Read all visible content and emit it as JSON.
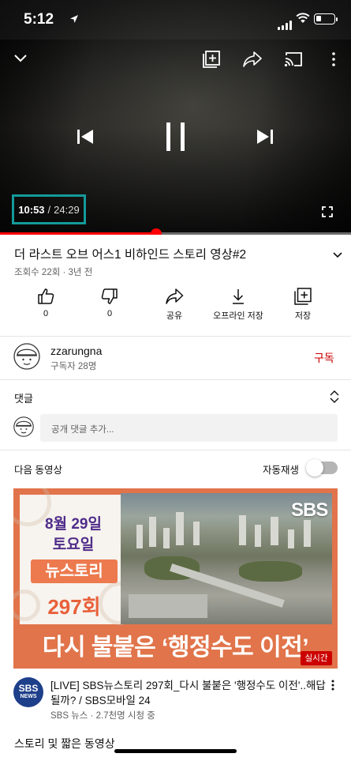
{
  "status_bar": {
    "time": "5:12",
    "battery_level": 0.3
  },
  "player": {
    "current_time": "10:53",
    "separator": "/",
    "duration": "24:29",
    "progress_fraction": 0.444
  },
  "video": {
    "title": "더 라스트 오브 어스1 비하인드 스토리 영상#2",
    "meta": "조회수 22회 · 3년 전"
  },
  "actions": [
    {
      "label": "0",
      "icon": "thumbs-up-icon"
    },
    {
      "label": "0",
      "icon": "thumbs-down-icon"
    },
    {
      "label": "공유",
      "icon": "share-icon"
    },
    {
      "label": "오프라인 저장",
      "icon": "download-icon"
    },
    {
      "label": "저장",
      "icon": "save-to-playlist-icon"
    }
  ],
  "channel": {
    "name": "zzarungna",
    "subscribers": "구독자 28명",
    "subscribe_label": "구독"
  },
  "comments": {
    "heading": "댓글",
    "placeholder": "공개 댓글 추가..."
  },
  "up_next": {
    "heading": "다음 동영상",
    "autoplay_label": "자동재생",
    "autoplay_on": false
  },
  "next_video": {
    "thumb_date": "8월 29일",
    "thumb_day": "토요일",
    "thumb_series": "뉴스토리",
    "thumb_episode": "297회",
    "thumb_logo": "SBS",
    "thumb_headline": "다시 불붙은 ‘행정수도 이전’",
    "live_badge": "실시간",
    "title": "[LIVE] SBS뉴스토리 297회_다시 불붙은 '행정수도 이전'..해답될까? / SBS모바일 24",
    "meta": "SBS 뉴스 · 2.7천명 시청 중",
    "channel_avatar_line1": "SBS",
    "channel_avatar_line2": "NEWS"
  },
  "section": {
    "heading": "스토리 및 짧은 동영상"
  },
  "colors": {
    "accent_red": "#ff0000",
    "subscribe_red": "#cc0000",
    "timebox_border": "#149a9a",
    "thumb_orange": "#e1744a"
  }
}
